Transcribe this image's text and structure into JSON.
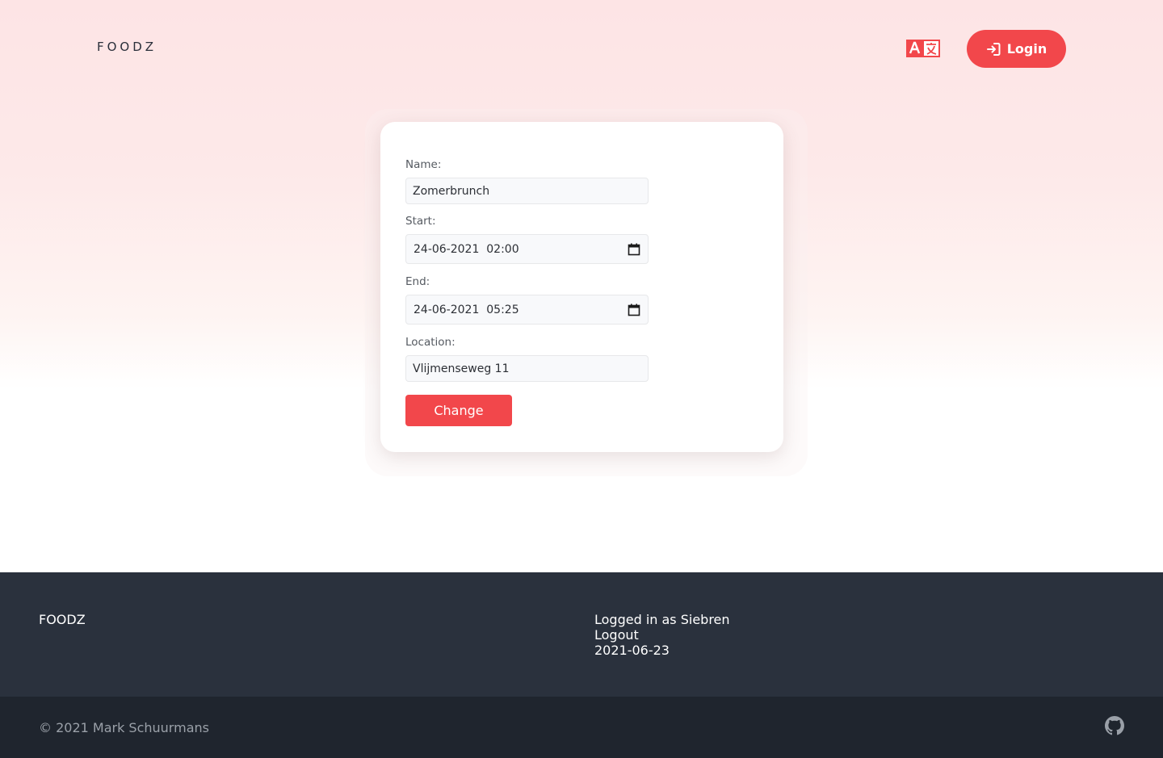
{
  "header": {
    "brand": "FOODZ",
    "translate_icon": "translate-icon",
    "login_label": "Login",
    "login_icon": "login-arrow-icon"
  },
  "form": {
    "name_label": "Name:",
    "name_value": "Zomerbrunch",
    "start_label": "Start:",
    "start_value": "24-06-2021  02:00",
    "end_label": "End:",
    "end_value": "24-06-2021  05:25",
    "location_label": "Location:",
    "location_value": "Vlijmenseweg 11",
    "calendar_icon": "calendar-icon",
    "submit_label": "Change"
  },
  "footer": {
    "brand": "FOODZ",
    "logged_in": "Logged in as Siebren",
    "logout": "Logout",
    "date": "2021-06-23",
    "copyright": "© 2021 Mark Schuurmans",
    "github_icon": "github-icon"
  },
  "colors": {
    "accent": "#f2474b",
    "footer_top": "#2a313d",
    "footer_bottom": "#1f252e",
    "hero_top": "#fde4e5"
  }
}
